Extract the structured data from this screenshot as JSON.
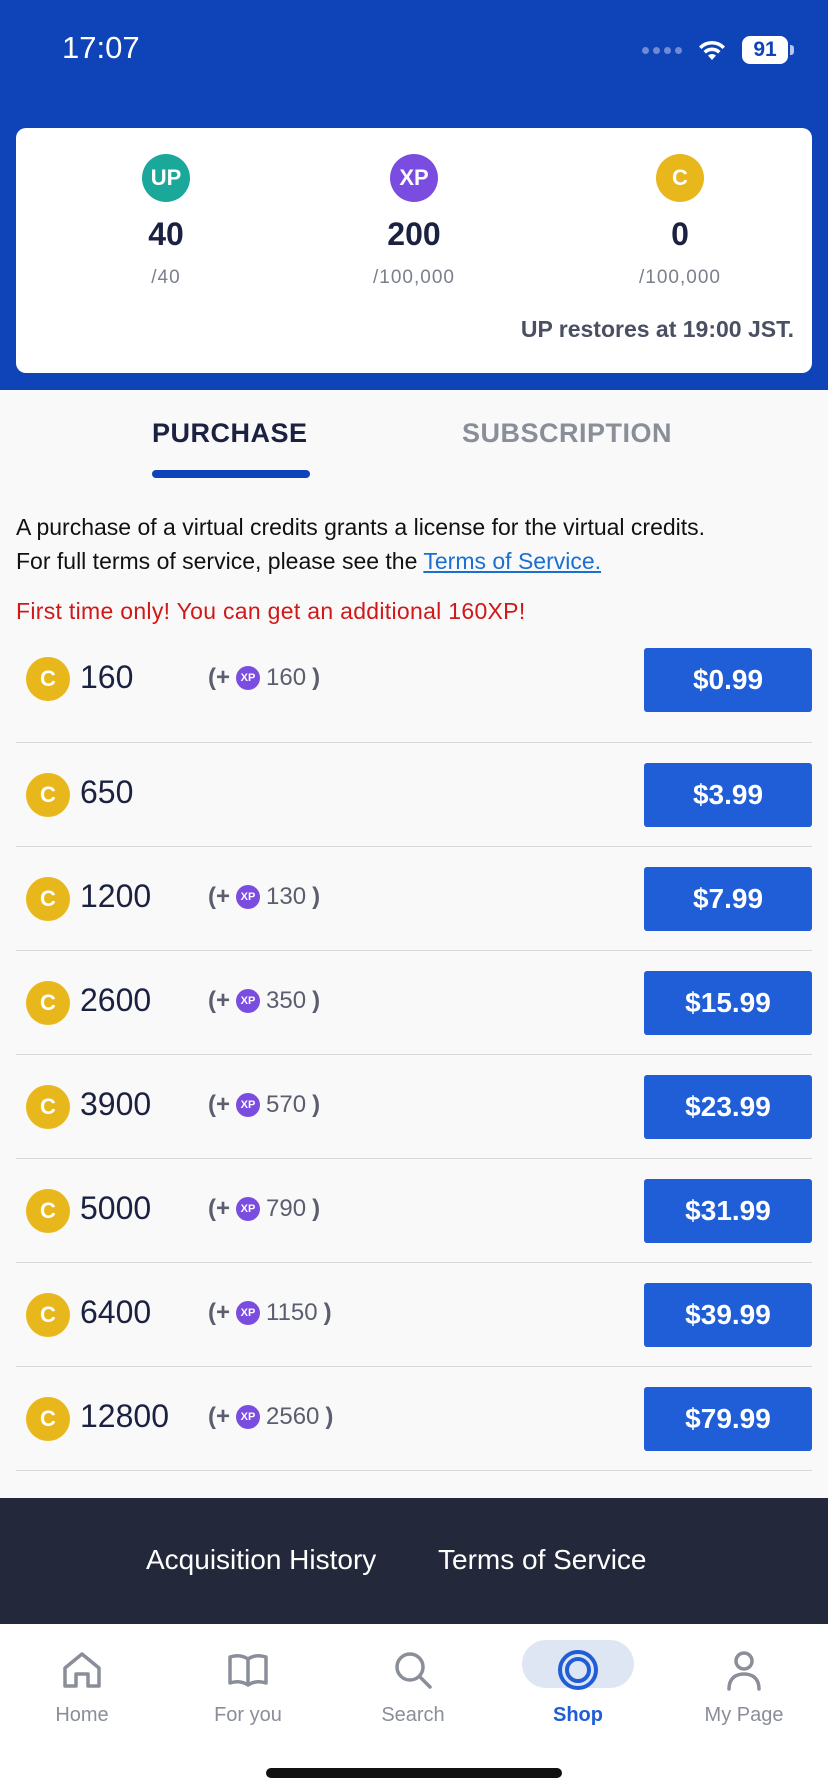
{
  "status_bar": {
    "time": "17:07",
    "battery": "91"
  },
  "stats": [
    {
      "icon": "UP",
      "color": "#1aa89a",
      "value": "40",
      "max": "/40"
    },
    {
      "icon": "XP",
      "color": "#7b4ce0",
      "value": "200",
      "max": "/100,000"
    },
    {
      "icon": "C",
      "color": "#e8b71b",
      "value": "0",
      "max": "/100,000"
    }
  ],
  "restore_text": "UP restores at 19:00 JST.",
  "tabs": {
    "purchase": "PURCHASE",
    "subscription": "SUBSCRIPTION"
  },
  "notice": {
    "line1": "A purchase of a virtual credits grants a license for the virtual credits.",
    "line2_prefix": "For full terms of service, please see the ",
    "link": "Terms of Service."
  },
  "promo": "First time only! You can get an additional 160XP!",
  "coin_glyph": "C",
  "xp_glyph": "XP",
  "bonus_prefix": "(+",
  "bonus_suffix": ")",
  "products": [
    {
      "amount": "160",
      "bonus": "160",
      "price": "$0.99"
    },
    {
      "amount": "650",
      "bonus": "",
      "price": "$3.99"
    },
    {
      "amount": "1200",
      "bonus": "130",
      "price": "$7.99"
    },
    {
      "amount": "2600",
      "bonus": "350",
      "price": "$15.99"
    },
    {
      "amount": "3900",
      "bonus": "570",
      "price": "$23.99"
    },
    {
      "amount": "5000",
      "bonus": "790",
      "price": "$31.99"
    },
    {
      "amount": "6400",
      "bonus": "1150",
      "price": "$39.99"
    },
    {
      "amount": "12800",
      "bonus": "2560",
      "price": "$79.99"
    }
  ],
  "footer": {
    "history": "Acquisition History",
    "terms": "Terms of Service"
  },
  "nav": [
    {
      "label": "Home",
      "icon": "home-icon"
    },
    {
      "label": "For you",
      "icon": "book-icon"
    },
    {
      "label": "Search",
      "icon": "search-icon"
    },
    {
      "label": "Shop",
      "icon": "shop-icon",
      "active": true
    },
    {
      "label": "My Page",
      "icon": "person-icon"
    }
  ]
}
